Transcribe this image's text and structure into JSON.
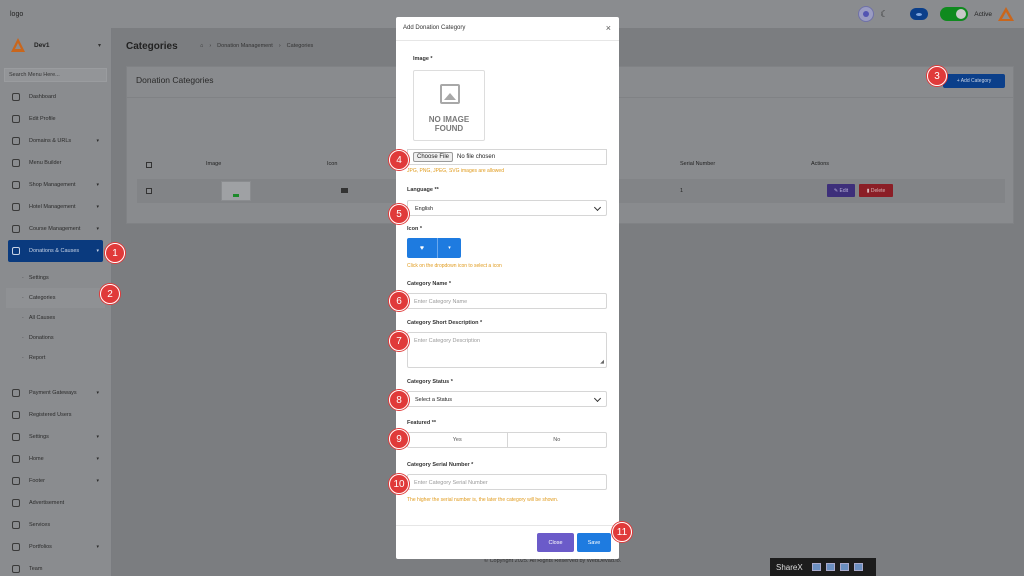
{
  "topbar": {
    "logo": "logo",
    "status_label": "Active"
  },
  "sidebar": {
    "user_name": "Dev1",
    "search_placeholder": "Search Menu Here...",
    "items": [
      {
        "label": "Dashboard"
      },
      {
        "label": "Edit Profile"
      },
      {
        "label": "Domains & URLs"
      },
      {
        "label": "Menu Builder"
      },
      {
        "label": "Shop Management"
      },
      {
        "label": "Hotel Management"
      },
      {
        "label": "Course Management"
      },
      {
        "label": "Donations & Causes"
      }
    ],
    "sub_items": [
      {
        "label": "Settings"
      },
      {
        "label": "Categories"
      },
      {
        "label": "All Causes"
      },
      {
        "label": "Donations"
      },
      {
        "label": "Report"
      }
    ],
    "items_after": [
      {
        "label": "Payment Gateways"
      },
      {
        "label": "Registered Users"
      },
      {
        "label": "Settings"
      },
      {
        "label": "Home"
      },
      {
        "label": "Footer"
      },
      {
        "label": "Advertisement"
      },
      {
        "label": "Services"
      },
      {
        "label": "Portfolios"
      },
      {
        "label": "Team"
      }
    ]
  },
  "main": {
    "page_title": "Categories",
    "breadcrumb": [
      "Donation Management",
      "Categories"
    ],
    "card_title": "Donation Categories",
    "add_button": "+ Add Category",
    "table_headers": [
      "Image",
      "Icon",
      "Serial Number",
      "Actions"
    ],
    "row": {
      "serial": "1",
      "edit": "Edit",
      "delete": "Delete"
    },
    "footer": "© Copyright 2025. All Rights Reserved by WebDevad.io."
  },
  "modal": {
    "title": "Add Donation Category",
    "close_icon": "×",
    "image_label": "Image *",
    "no_image": "NO IMAGE FOUND",
    "choose_file": "Choose File",
    "file_status": "No file chosen",
    "file_hint": "JPG, PNG, JPEG, SVG images are allowed",
    "language_label": "Language **",
    "language_value": "English",
    "icon_label": "Icon *",
    "icon_hint": "Click on the dropdown icon to select a icon",
    "name_label": "Category Name *",
    "name_placeholder": "Enter Category Name",
    "desc_label": "Category Short Description *",
    "desc_placeholder": "Enter Category Description",
    "status_label": "Category Status *",
    "status_value": "Select a Status",
    "featured_label": "Featured **",
    "featured_yes": "Yes",
    "featured_no": "No",
    "serial_label": "Category Serial Number *",
    "serial_placeholder": "Enter Category Serial Number",
    "serial_hint": "The higher the serial number is, the later the category will be shown.",
    "close_button": "Close",
    "save_button": "Save"
  },
  "markers": [
    "1",
    "2",
    "3",
    "4",
    "5",
    "6",
    "7",
    "8",
    "9",
    "10",
    "11"
  ],
  "taskbar": {
    "app": "ShareX"
  },
  "colors": {
    "primary": "#1e7be0",
    "marker": "#e03a3a",
    "hint": "#e09a1b",
    "close_btn": "#6b5bc9"
  }
}
